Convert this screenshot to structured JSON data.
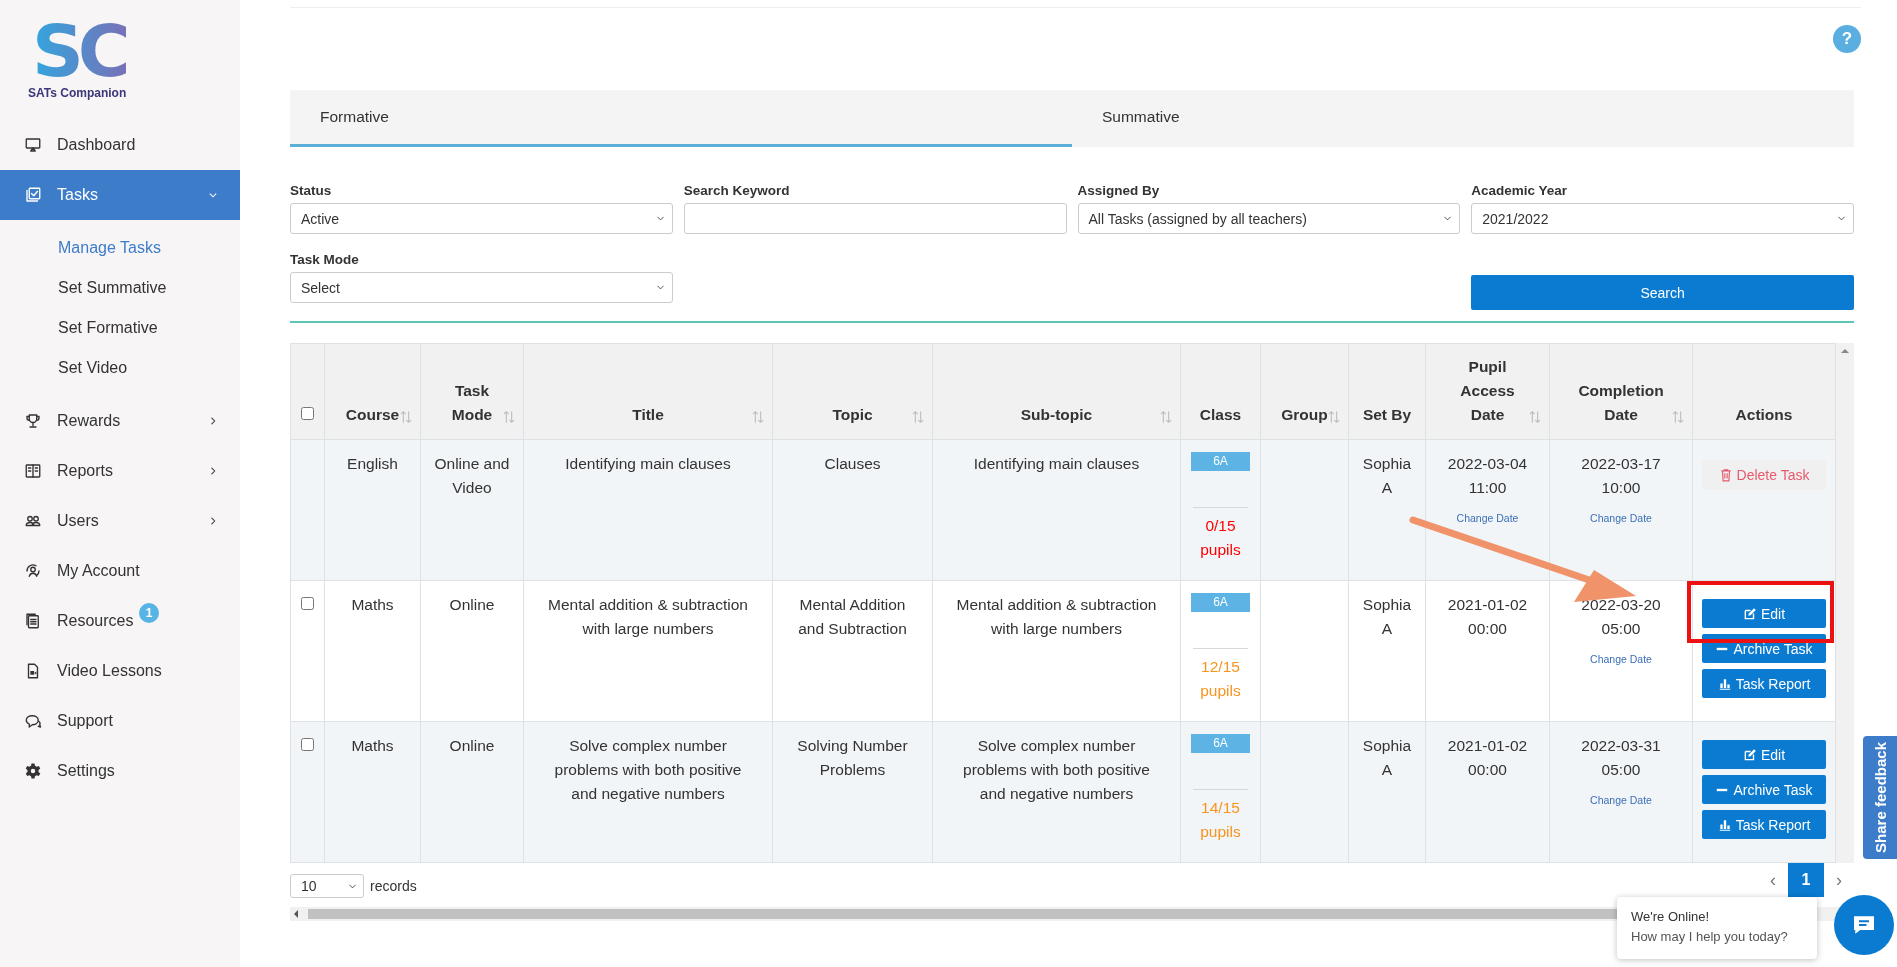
{
  "sidebar": {
    "logo": {
      "mark": "SC",
      "name": "SATs Companion"
    },
    "items": [
      {
        "label": "Dashboard",
        "selected": false
      },
      {
        "label": "Tasks",
        "selected": true,
        "expanded": true,
        "children": [
          {
            "label": "Manage Tasks",
            "selected": true
          },
          {
            "label": "Set Summative",
            "selected": false
          },
          {
            "label": "Set Formative",
            "selected": false
          },
          {
            "label": "Set Video",
            "selected": false
          }
        ]
      },
      {
        "label": "Rewards",
        "selected": false,
        "expanded": false
      },
      {
        "label": "Reports",
        "selected": false,
        "expanded": false
      },
      {
        "label": "Users",
        "selected": false,
        "expanded": false
      },
      {
        "label": "My Account",
        "selected": false
      },
      {
        "label": "Resources",
        "selected": false,
        "badge": "1"
      },
      {
        "label": "Video Lessons",
        "selected": false
      },
      {
        "label": "Support",
        "selected": false
      },
      {
        "label": "Settings",
        "selected": false
      }
    ]
  },
  "help": "?",
  "tabs": [
    {
      "label": "Formative",
      "selected": true
    },
    {
      "label": "Summative",
      "selected": false
    }
  ],
  "filters": {
    "fields": [
      {
        "label": "Status",
        "value": "Active"
      },
      {
        "label": "Search Keyword"
      },
      {
        "label": "Assigned By",
        "value": "All Tasks (assigned by all teachers)"
      },
      {
        "label": "Academic Year",
        "value": "2021/2022"
      },
      {
        "label": "Task Mode",
        "value": "Select"
      }
    ],
    "search_button": "Search"
  },
  "table": {
    "select_all": {
      "checked": false
    },
    "columns": [
      {
        "label": "Course",
        "sortable": true
      },
      {
        "label": "Task Mode",
        "sortable": true
      },
      {
        "label": "Title",
        "sortable": true
      },
      {
        "label": "Topic",
        "sortable": true
      },
      {
        "label": "Sub-topic",
        "sortable": true
      },
      {
        "label": "Class",
        "sortable": false
      },
      {
        "label": "Group",
        "sortable": true
      },
      {
        "label": "Set By",
        "sortable": false
      },
      {
        "label": "Pupil Access Date",
        "sortable": true
      },
      {
        "label": "Completion Date",
        "sortable": true
      },
      {
        "label": "Actions",
        "sortable": false
      }
    ],
    "rows": [
      {
        "course": "English",
        "task_mode": "Online and Video",
        "title": "Identifying main clauses",
        "topic": "Clauses",
        "sub_topic": "Identifying main clauses",
        "class": {
          "badge": "6A",
          "progress": "0/15 pupils",
          "color": "#ff0000"
        },
        "set_by": "Sophia A",
        "access_date": {
          "value": "2022-03-04 11:00",
          "link": "Change Date"
        },
        "completion_date": {
          "value": "2022-03-17 10:00",
          "link": "Change Date"
        },
        "actions": [
          {
            "kind": "delete",
            "label": "Delete Task"
          }
        ]
      },
      {
        "checked": false,
        "course": "Maths",
        "task_mode": "Online",
        "title": "Mental addition & subtraction with large numbers",
        "topic": "Mental Addition and Subtraction",
        "sub_topic": "Mental addition & subtraction with large numbers",
        "class": {
          "badge": "6A",
          "progress": "12/15 pupils",
          "color": "#f7941d"
        },
        "set_by": "Sophia A",
        "access_date": {
          "value": "2021-01-02 00:00"
        },
        "completion_date": {
          "value": "2022-03-20 05:00",
          "link": "Change Date"
        },
        "actions": [
          {
            "kind": "edit",
            "label": "Edit"
          },
          {
            "kind": "archive",
            "label": "Archive Task"
          },
          {
            "kind": "report",
            "label": "Task Report"
          }
        ]
      },
      {
        "checked": false,
        "course": "Maths",
        "task_mode": "Online",
        "title": "Solve complex number problems with both positive and negative numbers",
        "topic": "Solving Number Problems",
        "sub_topic": "Solve complex number problems with both positive and negative numbers",
        "class": {
          "badge": "6A",
          "progress": "14/15 pupils",
          "color": "#f7941d"
        },
        "set_by": "Sophia A",
        "access_date": {
          "value": "2021-01-02 00:00"
        },
        "completion_date": {
          "value": "2022-03-31 05:00",
          "link": "Change Date"
        },
        "actions": [
          {
            "kind": "edit",
            "label": "Edit"
          },
          {
            "kind": "archive",
            "label": "Archive Task"
          },
          {
            "kind": "report",
            "label": "Task Report"
          }
        ]
      }
    ]
  },
  "footer": {
    "page_size": "10",
    "records_label": "records",
    "pagination": [
      {
        "label": "‹",
        "kind": "prev",
        "selected": false
      },
      {
        "label": "1",
        "kind": "page",
        "selected": true
      },
      {
        "label": "›",
        "kind": "next",
        "selected": false
      }
    ]
  },
  "feedback_tab": "Share feedback",
  "chat": {
    "title": "We're Online!",
    "message": "How may I help you today?"
  }
}
